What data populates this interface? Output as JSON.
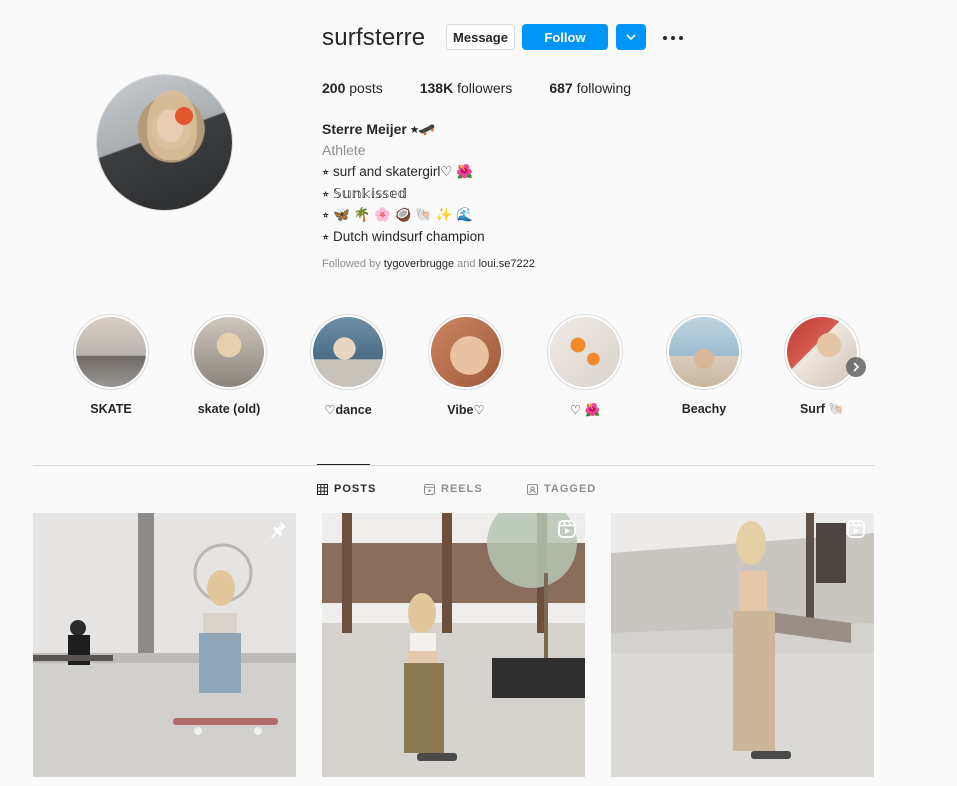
{
  "profile": {
    "username": "surfsterre",
    "message_label": "Message",
    "follow_label": "Follow",
    "full_name": "Sterre Meijer ⭒🛹",
    "category": "Athlete",
    "bio": [
      "⭒ surf and skatergirl♡ 🌺",
      "⭒ 𝕊𝕦𝕟𝕜𝕚𝕤𝕤𝕖𝕕",
      "⭒ 🦋 🌴 🌸 🥥 🐚 ✨ 🌊",
      "⭒ Dutch windsurf champion"
    ],
    "followed_by_prefix": "Followed by",
    "followed_by_user1": "tygoverbrugge",
    "followed_by_and": "and",
    "followed_by_user2": "loui.se7222"
  },
  "stats": {
    "posts_count": "200",
    "posts_label": "posts",
    "followers_count": "138K",
    "followers_label": "followers",
    "following_count": "687",
    "following_label": "following"
  },
  "highlights": [
    {
      "label": "SKATE"
    },
    {
      "label": "skate (old)"
    },
    {
      "label": "♡dance"
    },
    {
      "label": "Vibe♡"
    },
    {
      "label": "♡ 🌺"
    },
    {
      "label": "Beachy"
    },
    {
      "label": "Surf 🐚"
    }
  ],
  "tabs": {
    "posts": "POSTS",
    "reels": "REELS",
    "tagged": "TAGGED"
  },
  "colors": {
    "accent": "#0095f6",
    "text": "#262626",
    "muted": "#8e8e8e",
    "border": "#dbdbdb",
    "background": "#fafafa"
  },
  "icons": {
    "post1_badge": "pin-icon",
    "post2_badge": "reels-icon",
    "post3_badge": "reels-icon"
  }
}
